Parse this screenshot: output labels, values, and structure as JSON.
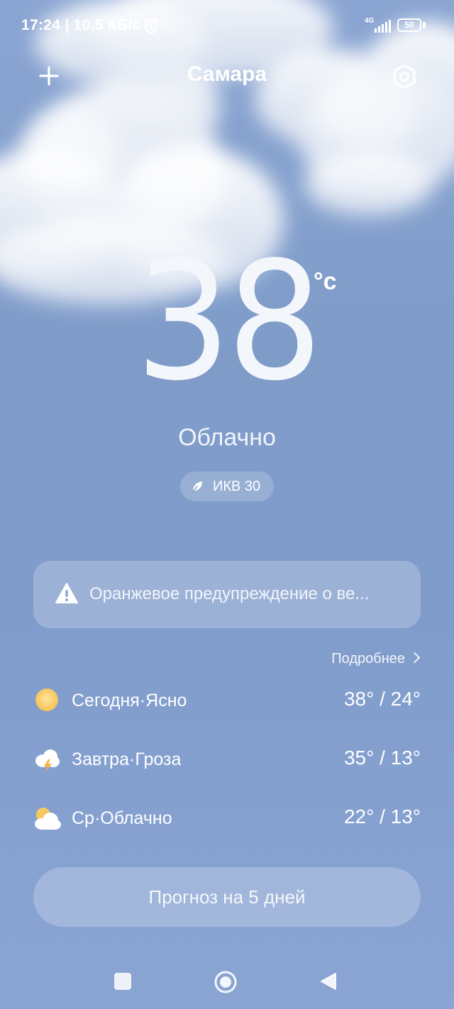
{
  "statusbar": {
    "time_speed": "17:24 | 10,5 КБ/с",
    "network": "4G",
    "battery": "58"
  },
  "header": {
    "city": "Самара"
  },
  "current": {
    "temperature": "38",
    "unit": "°c",
    "condition": "Облачно",
    "aqi": "ИКВ 30"
  },
  "alert": {
    "text": "Оранжевое предупреждение о ве..."
  },
  "forecast": {
    "more_label": "Подробнее",
    "days": [
      {
        "label": "Сегодня·Ясно",
        "temps": "38° / 24°",
        "icon": "sun-icon"
      },
      {
        "label": "Завтра·Гроза",
        "temps": "35° / 13°",
        "icon": "thunderstorm-icon"
      },
      {
        "label": "Ср·Облачно",
        "temps": "22° / 13°",
        "icon": "partly-cloudy-icon"
      }
    ],
    "button_label": "Прогноз на 5 дней"
  },
  "colors": {
    "sky_top": "#8aa5d2",
    "sky_bottom": "#8aa5d3",
    "sun": "#f6c55c"
  }
}
